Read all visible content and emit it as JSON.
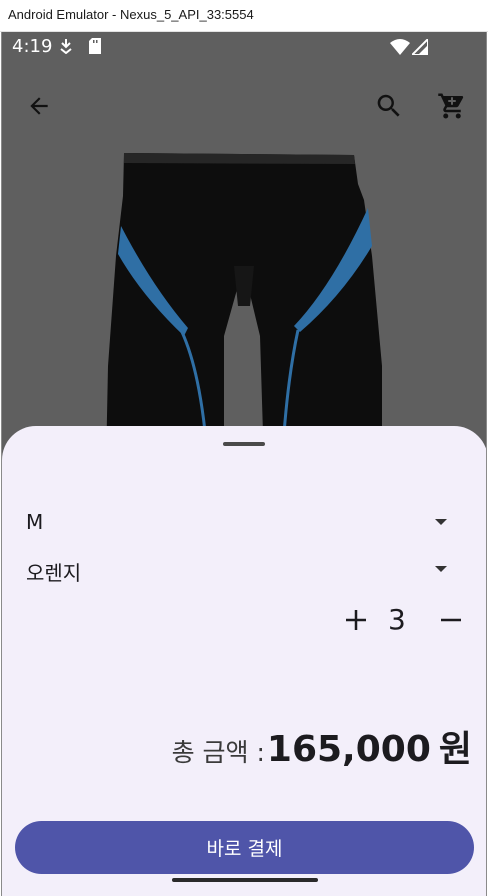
{
  "window": {
    "title": "Android Emulator - Nexus_5_API_33:5554"
  },
  "status_bar": {
    "time": "4:19"
  },
  "app_bar": {
    "back_icon": "arrow-back-icon",
    "search_icon": "search-icon",
    "cart_icon": "shopping-cart-icon"
  },
  "product": {
    "image": "swim-jammer-shorts"
  },
  "sheet": {
    "size_option": "M",
    "color_option": "오렌지",
    "quantity": "3",
    "total_label": "총 금액 :",
    "total_amount": "165,000",
    "total_unit": "원",
    "pay_button": "바로 결제"
  },
  "colors": {
    "sheet_bg": "#f3effa",
    "button": "#4f55a9",
    "scrim": "#5f5f5f"
  }
}
